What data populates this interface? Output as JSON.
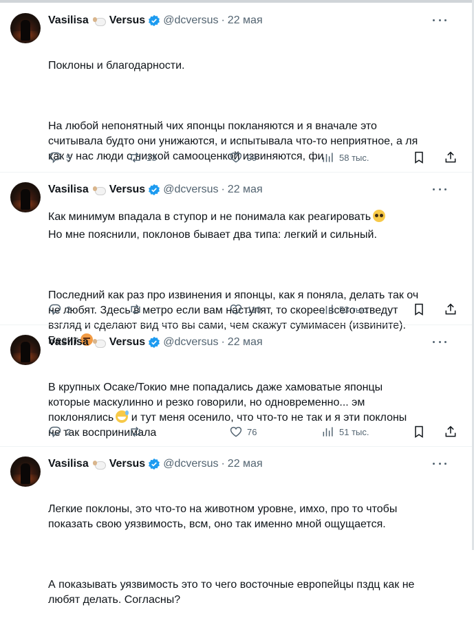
{
  "tweets": [
    {
      "name": "Vasilisa",
      "name_suffix": "Versus",
      "handle": "@dcversus",
      "date": "22 мая",
      "paragraphs": [
        "Поклоны и благодарности.",
        "На любой непонятный чих японцы покланяются и я вначале это\nсчитывала будто они унижаются, и испытывала что-то неприятное, а ля\nкак у нас люди с низкой самооценкой извиняются, фи",
        "Как минимум впадала в ступор и не понимала как реагировать"
      ],
      "replies": "5",
      "retweets": "13",
      "likes": "99",
      "views": "58 тыс."
    },
    {
      "name": "Vasilisa",
      "name_suffix": "Versus",
      "handle": "@dcversus",
      "date": "22 мая",
      "paragraphs": [
        "Но мне пояснили, поклонов бывает два типа: легкий и сильный.",
        "Последний как раз про извинения и японцы, как я поняла, делать так оч\nне любят. Здесь в метро если вам наступят, то скорее всего отведут\nвзгляд и сделают вид что вы сами, чем скажут сумимасен (извините).\nБесит"
      ],
      "replies": "2",
      "retweets": "",
      "likes": "110",
      "views": "53 тыс."
    },
    {
      "name": "Vasilisa",
      "name_suffix": "Versus",
      "handle": "@dcversus",
      "date": "22 мая",
      "paragraphs": [
        "В крупных Осаке/Токио мне попадались даже хамоватые японцы\nкоторые маскулинно и резко говорили, но одновременно... эм\nпоклонялись",
        " и тут меня осенило, что что-то не так и я эти поклоны\nне так воспринимала"
      ],
      "replies": "2",
      "retweets": "",
      "likes": "76",
      "views": "51 тыс."
    },
    {
      "name": "Vasilisa",
      "name_suffix": "Versus",
      "handle": "@dcversus",
      "date": "22 мая",
      "paragraphs": [
        "Легкие поклоны, это что-то на животном уровне, имхо, про то чтобы\nпоказать свою уязвимость, всм, оно так именно мной ощущается.",
        "А показывать уязвимость это то чего восточные европейцы пздц как не\nлюбят делать. Согласны?"
      ]
    }
  ],
  "colors": {
    "text": "#0f1419",
    "muted": "#536471",
    "verified": "#1d9bf0",
    "separator": "#eff3f4"
  },
  "icons": [
    "sheep-emoji-icon",
    "verified-badge-icon",
    "more-icon",
    "reply-icon",
    "retweet-icon",
    "like-icon",
    "views-icon",
    "bookmark-icon",
    "share-icon",
    "pleading-face-emoji",
    "angry-face-emoji",
    "grinning-sweat-emoji"
  ]
}
